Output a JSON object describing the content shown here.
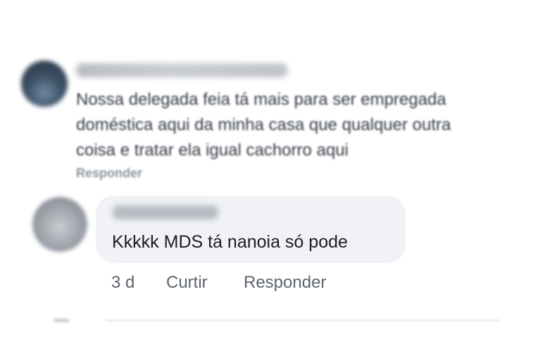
{
  "top_comment": {
    "text": "Nossa delegada feia tá mais para ser empregada\ndoméstica aqui da minha casa que qualquer outra\ncoisa e tratar ela igual cachorro aqui",
    "reply_label": "Responder"
  },
  "reply_comment": {
    "text": "Kkkkk MDS tá nanoia só pode",
    "time": "3 d",
    "like_label": "Curtir",
    "reply_label": "Responder"
  },
  "colors": {
    "bubble": "#f0f2f5",
    "text_primary": "#1c1e21",
    "text_secondary": "#5d6470"
  }
}
